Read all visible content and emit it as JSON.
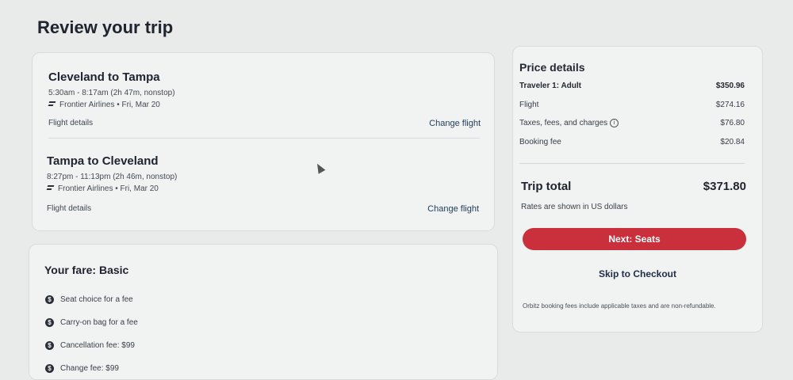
{
  "page": {
    "title": "Review your trip"
  },
  "flights": [
    {
      "route": "Cleveland to Tampa",
      "times": "5:30am - 8:17am (2h 47m, nonstop)",
      "airline": "Frontier Airlines • Fri, Mar 20",
      "details_label": "Flight details",
      "change_label": "Change flight"
    },
    {
      "route": "Tampa to Cleveland",
      "times": "8:27pm - 11:13pm (2h 46m, nonstop)",
      "airline": "Frontier Airlines • Fri, Mar 20",
      "details_label": "Flight details",
      "change_label": "Change flight"
    }
  ],
  "fare": {
    "title": "Your fare: Basic",
    "items": [
      {
        "icon": "dollar-icon",
        "label": "Seat choice for a fee"
      },
      {
        "icon": "dollar-icon",
        "label": "Carry-on bag for a fee"
      },
      {
        "icon": "dollar-icon",
        "label": "Cancellation fee: $99"
      },
      {
        "icon": "dollar-icon",
        "label": "Change fee: $99"
      }
    ]
  },
  "price": {
    "title": "Price details",
    "rows": [
      {
        "label": "Traveler 1: Adult",
        "value": "$350.96"
      },
      {
        "label": "Flight",
        "value": "$274.16"
      },
      {
        "label": "Taxes, fees, and charges",
        "value": "$76.80"
      },
      {
        "label": "Booking fee",
        "value": "$20.84"
      }
    ],
    "total_label": "Trip total",
    "total_value": "$371.80",
    "rates_note": "Rates are shown in US dollars",
    "next_button": "Next: Seats",
    "skip_link": "Skip to Checkout",
    "fee_note": "Orbitz booking fees include applicable taxes and are non-refundable."
  },
  "colors": {
    "accent": "#c9303b",
    "background": "#e9ebea"
  }
}
